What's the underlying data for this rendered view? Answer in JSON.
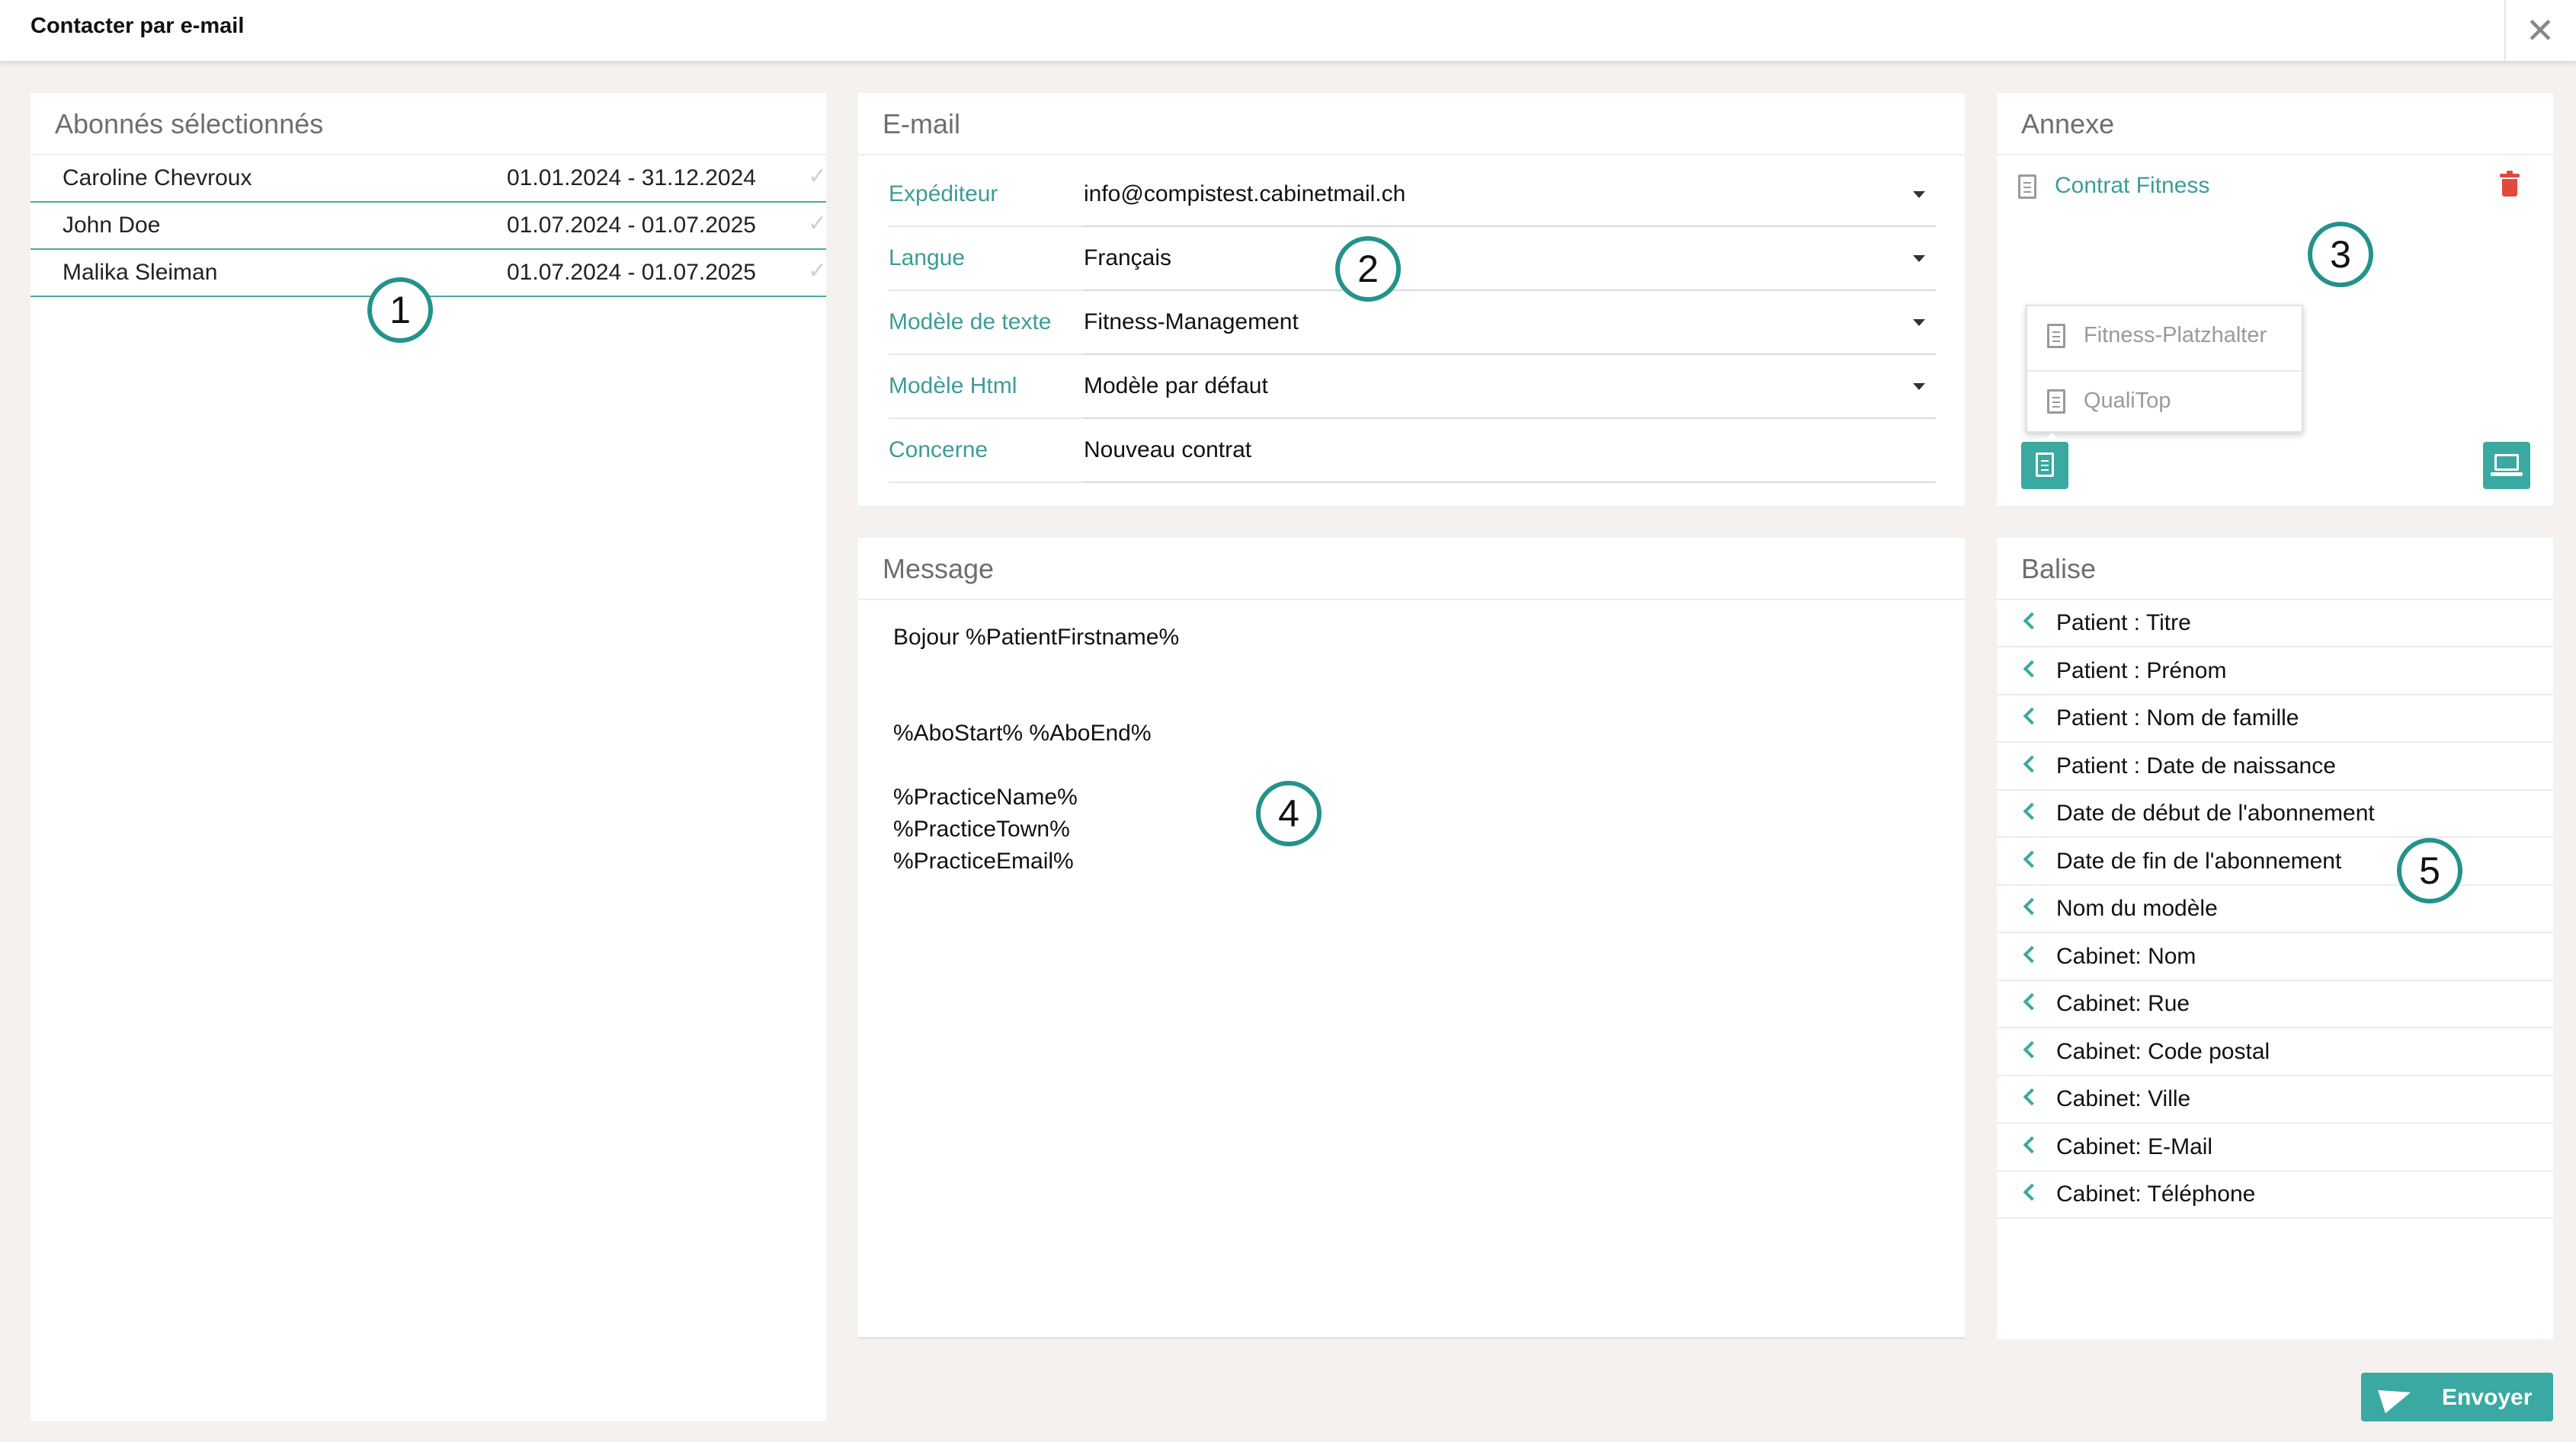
{
  "window": {
    "title": "Contacter par e-mail",
    "close_glyph": "✕"
  },
  "subscribers": {
    "header": "Abonnés sélectionnés",
    "rows": [
      {
        "name": "Caroline Chevroux",
        "period": "01.01.2024 - 31.12.2024",
        "check_icon": "check-icon"
      },
      {
        "name": "John Doe",
        "period": "01.07.2024 - 01.07.2025",
        "check_icon": "check-icon"
      },
      {
        "name": "Malika  Sleiman",
        "period": "01.07.2024 - 01.07.2025",
        "check_icon": "check-icon"
      }
    ],
    "check_glyph": "✓"
  },
  "email": {
    "header": "E-mail",
    "fields": [
      {
        "label": "Expéditeur",
        "value": "info@compistest.cabinetmail.ch",
        "dropdown": true
      },
      {
        "label": "Langue",
        "value": "Français",
        "dropdown": true
      },
      {
        "label": "Modèle de texte",
        "value": "Fitness-Management",
        "dropdown": true
      },
      {
        "label": "Modèle Html",
        "value": "Modèle par défaut",
        "dropdown": true
      },
      {
        "label": "Concerne",
        "value": "Nouveau  contrat",
        "dropdown": false
      }
    ]
  },
  "annex": {
    "header": "Annexe",
    "attachments": [
      "Contrat Fitness"
    ],
    "dropdown_options": [
      "Fitness-Platzhalter",
      "QualiTop"
    ],
    "icons": {
      "attachment": "document-icon",
      "delete": "trash-icon",
      "add_document": "document-icon",
      "local_file": "laptop-icon"
    }
  },
  "message": {
    "header": "Message",
    "body": "Bojour %PatientFirstname%\n\n\n%AboStart% %AboEnd%\n\n%PracticeName%\n%PracticeTown%\n%PracticeEmail%"
  },
  "tags": {
    "header": "Balise",
    "items": [
      "Patient : Titre",
      "Patient : Prénom",
      "Patient : Nom de famille",
      "Patient : Date de naissance",
      "Date de début de l'abonnement",
      "Date de fin de l'abonnement",
      "Nom du modèle",
      "Cabinet: Nom",
      "Cabinet: Rue",
      "Cabinet: Code postal",
      "Cabinet: Ville",
      "Cabinet: E-Mail",
      "Cabinet: Téléphone"
    ],
    "item_icon": "chevron-left-icon"
  },
  "actions": {
    "send_label": "Envoyer",
    "send_icon": "paper-plane-icon"
  },
  "callouts": [
    "1",
    "2",
    "3",
    "4",
    "5"
  ],
  "colors": {
    "accent": "#3aa9a1",
    "label_teal": "#3c9c98",
    "delete_red": "#e04a3a",
    "background": "#f4f1ee"
  }
}
